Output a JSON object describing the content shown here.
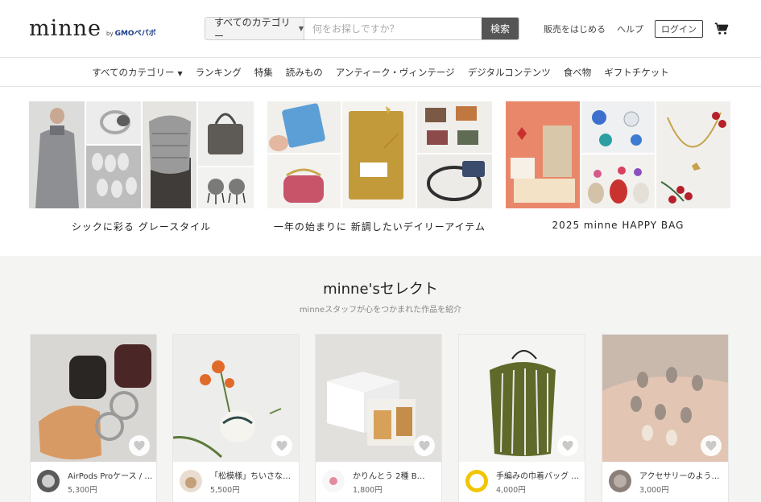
{
  "header": {
    "logo": "minne",
    "logo_by": "by",
    "logo_gmo": "GMOペパボ",
    "search": {
      "category": "すべてのカテゴリー",
      "placeholder": "何をお探しですか？",
      "button": "検索"
    },
    "links": {
      "sell": "販売をはじめる",
      "help": "ヘルプ",
      "login": "ログイン"
    }
  },
  "nav": {
    "items": [
      "すべてのカテゴリー",
      "ランキング",
      "特集",
      "読みもの",
      "アンティーク・ヴィンテージ",
      "デジタルコンテンツ",
      "食べ物",
      "ギフトチケット"
    ]
  },
  "banners": [
    {
      "caption": "シックに彩る グレースタイル"
    },
    {
      "caption": "一年の始まりに 新調したいデイリーアイテム"
    },
    {
      "caption": "2025 minne HAPPY BAG"
    }
  ],
  "select": {
    "title": "minne'sセレクト",
    "subtitle": "minneスタッフが心をつかまれた作品を紹介",
    "cards": [
      {
        "title": "AirPods Proケース / …",
        "price": "5,300円"
      },
      {
        "title": "「松模様」ちいさな…",
        "price": "5,500円"
      },
      {
        "title": "かりんとう 2種 B…",
        "price": "1,800円"
      },
      {
        "title": "手編みの巾着バッグ …",
        "price": "4,000円"
      },
      {
        "title": "アクセサリーのよう…",
        "price": "3,000円"
      }
    ]
  },
  "colors": {
    "search_button": "#555555",
    "section_bg": "#f4f4f2"
  }
}
